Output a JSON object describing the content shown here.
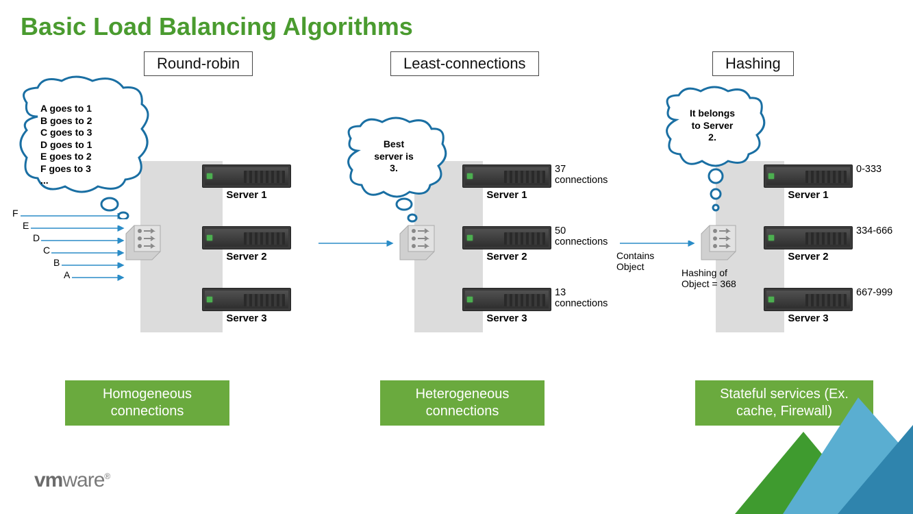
{
  "title": "Basic Load Balancing Algorithms",
  "columns": {
    "round_robin": {
      "label": "Round-robin",
      "cloud_lines": [
        "A goes to 1",
        "B goes to 2",
        "C goes to 3",
        "D goes to 1",
        "E goes to 2",
        "F goes to 3",
        "..."
      ],
      "requests": [
        "A",
        "B",
        "C",
        "D",
        "E",
        "F"
      ],
      "servers": [
        {
          "name": "Server 1"
        },
        {
          "name": "Server 2"
        },
        {
          "name": "Server 3"
        }
      ],
      "footer": "Homogeneous connections"
    },
    "least_conn": {
      "label": "Least-connections",
      "cloud_lines": [
        "Best",
        "server is",
        "3."
      ],
      "servers": [
        {
          "name": "Server 1",
          "side_l1": "37",
          "side_l2": "connections"
        },
        {
          "name": "Server 2",
          "side_l1": "50",
          "side_l2": "connections"
        },
        {
          "name": "Server 3",
          "side_l1": "13",
          "side_l2": "connections"
        }
      ],
      "footer": "Heterogeneous connections"
    },
    "hashing": {
      "label": "Hashing",
      "cloud_lines": [
        "It belongs",
        "to Server",
        "2."
      ],
      "incoming_l1": "Contains",
      "incoming_l2": "Object",
      "lb_caption_l1": "Hashing of",
      "lb_caption_l2": "Object = 368",
      "servers": [
        {
          "name": "Server 1",
          "side_l1": "0-333",
          "side_l2": ""
        },
        {
          "name": "Server 2",
          "side_l1": "334-666",
          "side_l2": ""
        },
        {
          "name": "Server 3",
          "side_l1": "667-999",
          "side_l2": ""
        }
      ],
      "footer": "Stateful services (Ex. cache, Firewall)"
    }
  },
  "brand": "vmware",
  "colors": {
    "title": "#4a9b2f",
    "cloud_stroke": "#1a6fa3",
    "green": "#6aaa3e",
    "tri1": "#3f9b2f",
    "tri2": "#5aaed1",
    "tri3": "#2f84ad"
  }
}
